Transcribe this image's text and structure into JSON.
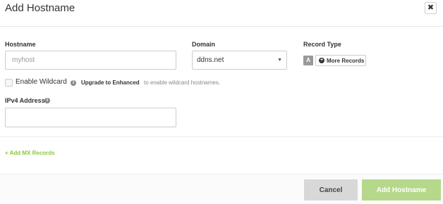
{
  "modal": {
    "title": "Add Hostname",
    "close_icon": "close-icon"
  },
  "form": {
    "hostname": {
      "label": "Hostname",
      "placeholder": "myhost",
      "value": ""
    },
    "domain": {
      "label": "Domain",
      "selected": "ddns.net",
      "arrow_icon": "caret-down-icon"
    },
    "record_type": {
      "label": "Record Type",
      "selected_badge": "A",
      "more_label": "More Records",
      "more_icon": "plus-circle-icon"
    },
    "wildcard": {
      "label": "Enable Wildcard",
      "checked": false,
      "info_icon": "info-icon",
      "upgrade_link": "Upgrade to Enhanced",
      "upgrade_text": "to enable wildcard hostnames."
    },
    "ipv4": {
      "label": "IPv4 Address",
      "info_icon": "info-icon",
      "value": ""
    },
    "add_mx": {
      "label": "+ Add MX Records"
    }
  },
  "footer": {
    "cancel_label": "Cancel",
    "submit_label": "Add Hostname"
  },
  "colors": {
    "accent_green": "#8dc63f",
    "submit_bg": "#b5d88a",
    "cancel_bg": "#d8d8d8",
    "badge_bg": "#999999"
  }
}
